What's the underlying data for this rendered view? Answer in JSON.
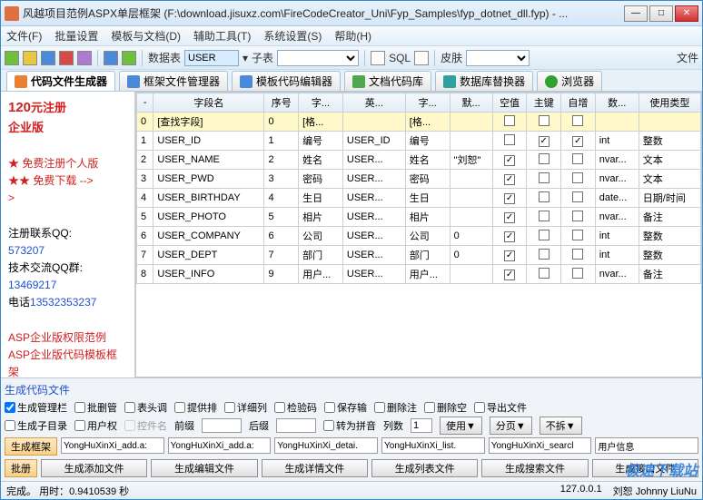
{
  "window": {
    "title": "风越项目范例ASPX单层框架 (F:\\download.jisuxz.com\\FireCodeCreator_Uni\\Fyp_Samples\\fyp_dotnet_dll.fyp) - ..."
  },
  "menu": [
    "文件(F)",
    "批量设置",
    "模板与文档(D)",
    "辅助工具(T)",
    "系统设置(S)",
    "帮助(H)"
  ],
  "toolbar": {
    "data_table_label": "数据表",
    "data_table_value": "USER",
    "child_label": "子表",
    "sql_label": "SQL",
    "skin_label": "皮肤",
    "file_label": "文件"
  },
  "tabs": [
    {
      "label": "代码文件生成器",
      "active": true
    },
    {
      "label": "框架文件管理器"
    },
    {
      "label": "模板代码编辑器"
    },
    {
      "label": "文档代码库"
    },
    {
      "label": "数据库替换器"
    },
    {
      "label": "浏览器"
    }
  ],
  "sidebar": {
    "promo_price": "120",
    "promo_unit": "元注册",
    "promo_line2": "企业版",
    "star_free_reg": "★ 免费注册个人版",
    "star_free_dl": "★★ 免费下载 -->",
    "contact_qq_label": "注册联系QQ:",
    "contact_qq": "573207",
    "tech_qq_label": "技术交流QQ群:",
    "tech_qq": "13469217",
    "phone_label": "电话",
    "phone": "13532353237",
    "asp1": "ASP企业版权限范例",
    "asp2": "ASP企业版代码模板框架"
  },
  "grid": {
    "headers": [
      "-",
      "字段名",
      "序号",
      "字...",
      "英...",
      "字...",
      "默...",
      "空值",
      "主键",
      "自增",
      "数...",
      "使用类型"
    ],
    "rows": [
      {
        "idx": "0",
        "name": "[查找字段]",
        "seq": "0",
        "a": "[格...",
        "b": "",
        "c": "[格...",
        "d": "",
        "nv": false,
        "pk": false,
        "ai": false,
        "dt": "",
        "ut": "",
        "sel": true
      },
      {
        "idx": "1",
        "name": "USER_ID",
        "seq": "1",
        "a": "编号",
        "b": "USER_ID",
        "c": "编号",
        "d": "",
        "nv": false,
        "pk": true,
        "ai": true,
        "dt": "int",
        "ut": "整数"
      },
      {
        "idx": "2",
        "name": "USER_NAME",
        "seq": "2",
        "a": "姓名",
        "b": "USER...",
        "c": "姓名",
        "d": "\"刘恕\"",
        "nv": true,
        "pk": false,
        "ai": false,
        "dt": "nvar...",
        "ut": "文本"
      },
      {
        "idx": "3",
        "name": "USER_PWD",
        "seq": "3",
        "a": "密码",
        "b": "USER...",
        "c": "密码",
        "d": "",
        "nv": true,
        "pk": false,
        "ai": false,
        "dt": "nvar...",
        "ut": "文本"
      },
      {
        "idx": "4",
        "name": "USER_BIRTHDAY",
        "seq": "4",
        "a": "生日",
        "b": "USER...",
        "c": "生日",
        "d": "",
        "nv": true,
        "pk": false,
        "ai": false,
        "dt": "date...",
        "ut": "日期/时间"
      },
      {
        "idx": "5",
        "name": "USER_PHOTO",
        "seq": "5",
        "a": "相片",
        "b": "USER...",
        "c": "相片",
        "d": "",
        "nv": true,
        "pk": false,
        "ai": false,
        "dt": "nvar...",
        "ut": "备注"
      },
      {
        "idx": "6",
        "name": "USER_COMPANY",
        "seq": "6",
        "a": "公司",
        "b": "USER...",
        "c": "公司",
        "d": "0",
        "nv": true,
        "pk": false,
        "ai": false,
        "dt": "int",
        "ut": "整数"
      },
      {
        "idx": "7",
        "name": "USER_DEPT",
        "seq": "7",
        "a": "部门",
        "b": "USER...",
        "c": "部门",
        "d": "0",
        "nv": true,
        "pk": false,
        "ai": false,
        "dt": "int",
        "ut": "整数"
      },
      {
        "idx": "8",
        "name": "USER_INFO",
        "seq": "9",
        "a": "用户...",
        "b": "USER...",
        "c": "用户...",
        "d": "",
        "nv": true,
        "pk": false,
        "ai": false,
        "dt": "nvar...",
        "ut": "备注"
      }
    ]
  },
  "options": {
    "section": "生成代码文件",
    "row1": [
      {
        "label": "生成管理栏",
        "chk": true
      },
      {
        "label": "批删管",
        "chk": false
      },
      {
        "label": "表头调",
        "chk": false
      },
      {
        "label": "提供排",
        "chk": false
      },
      {
        "label": "详细列",
        "chk": false
      },
      {
        "label": "检验码",
        "chk": false
      },
      {
        "label": "保存输",
        "chk": false
      },
      {
        "label": "删除注",
        "chk": false
      },
      {
        "label": "删除空",
        "chk": false
      },
      {
        "label": "导出文件",
        "chk": false
      }
    ],
    "row2": [
      {
        "label": "生成子目录",
        "chk": false
      },
      {
        "label": "用户权",
        "chk": false
      },
      {
        "label": "控件名",
        "chk": false,
        "disabled": true
      }
    ],
    "prefix_label": "前缀",
    "suffix_label": "后缀",
    "to_pinyin": "转为拼音",
    "cols_label": "列数",
    "cols_val": "1",
    "use_label": "使用▼",
    "page_label": "分页▼",
    "style_label": "不拆▼"
  },
  "buttons_row1": {
    "gen_frame": "生成框架",
    "f1": "YongHuXinXi_add.a:",
    "f2": "YongHuXinXi_add.a:",
    "f3": "YongHuXinXi_detai.",
    "f4": "YongHuXinXi_list.",
    "f5": "YongHuXinXi_searcl",
    "f6": "用户信息"
  },
  "buttons_row2": {
    "batch": "批册",
    "b1": "生成添加文件",
    "b2": "生成编辑文件",
    "b3": "生成详情文件",
    "b4": "生成列表文件",
    "b5": "生成搜索文件",
    "b6": "生成接口文件"
  },
  "status": {
    "done": "完成。",
    "time_label": "用时：",
    "time": "0.9410539 秒",
    "ip": "127.0.0.1",
    "user": "刘恕 Johnny LiuNu"
  },
  "watermark": "极速下载站"
}
